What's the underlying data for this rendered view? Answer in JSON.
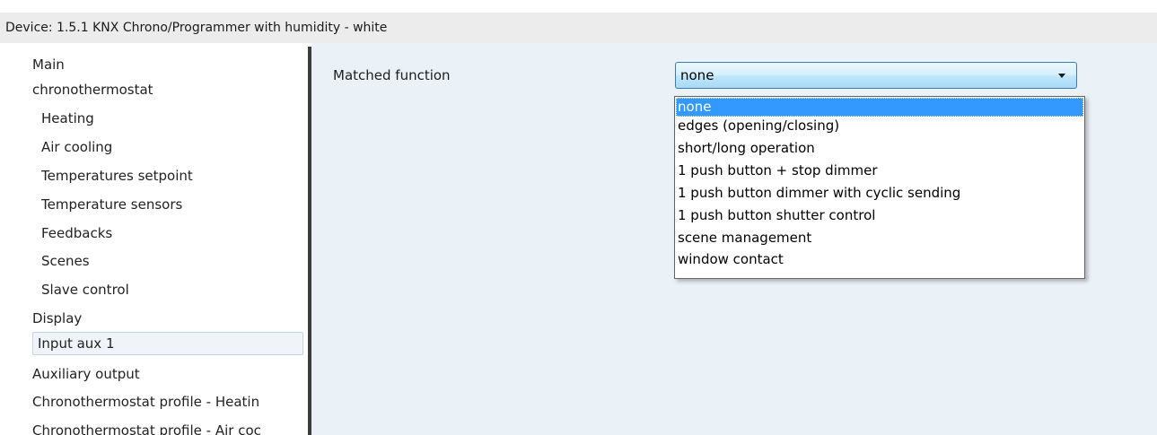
{
  "window": {
    "title": "Device: 1.5.1  KNX Chrono/Programmer with humidity - white"
  },
  "nav": {
    "items": [
      {
        "label": "Main",
        "level": 0
      },
      {
        "label": "chronothermostat",
        "level": 0
      },
      {
        "label": "Heating",
        "level": 1
      },
      {
        "label": "Air cooling",
        "level": 1
      },
      {
        "label": "Temperatures setpoint",
        "level": 1
      },
      {
        "label": "Temperature sensors",
        "level": 1
      },
      {
        "label": "Feedbacks",
        "level": 1
      },
      {
        "label": "Scenes",
        "level": 1
      },
      {
        "label": "Slave control",
        "level": 1
      },
      {
        "label": "Display",
        "level": 0
      },
      {
        "label": "Input aux 1",
        "level": 0,
        "selected": true
      },
      {
        "label": "Auxiliary output",
        "level": 0
      },
      {
        "label": "Chronothermostat profile - Heatin",
        "level": 0
      },
      {
        "label": "Chronothermostat profile - Air coc",
        "level": 0
      }
    ]
  },
  "main": {
    "param_label": "Matched function",
    "combo": {
      "value": "none",
      "expanded": true,
      "options": [
        "none",
        "edges (opening/closing)",
        "short/long operation",
        "1 push button + stop dimmer",
        "1 push button dimmer with cyclic sending",
        "1 push button shutter control",
        "scene management",
        "window contact"
      ],
      "selected_index": 0
    }
  },
  "colors": {
    "selection": "#3399ff",
    "panel_background": "#eaf1f7",
    "title_bar": "#ececec"
  }
}
